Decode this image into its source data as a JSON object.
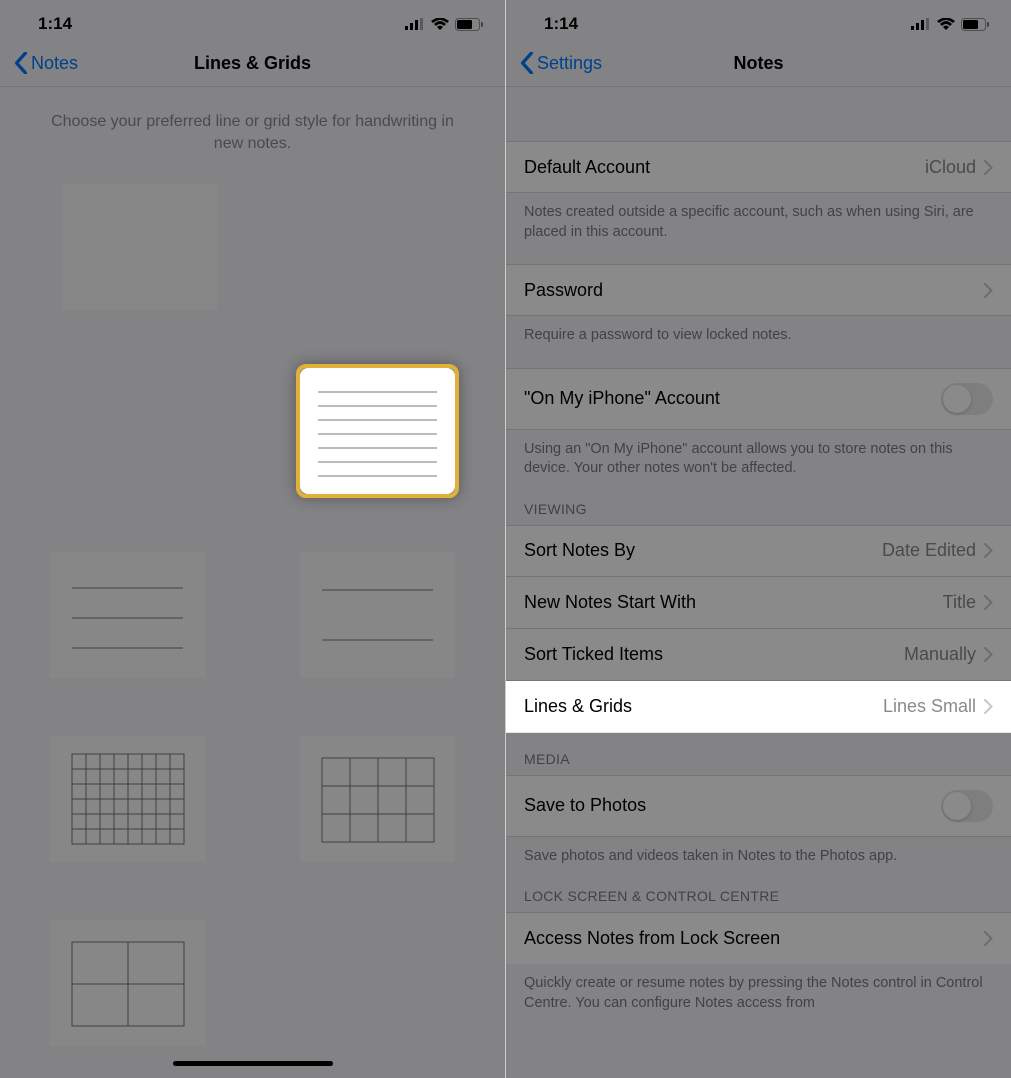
{
  "status": {
    "time": "1:14"
  },
  "left": {
    "back": "Notes",
    "title": "Lines & Grids",
    "desc": "Choose your preferred line or grid style for handwriting in new notes.",
    "swatches": [
      {
        "name": "blank"
      },
      {
        "name": "lines-small",
        "selected": true
      },
      {
        "name": "lines-medium"
      },
      {
        "name": "lines-large"
      },
      {
        "name": "grid-small"
      },
      {
        "name": "grid-medium"
      },
      {
        "name": "grid-large"
      }
    ]
  },
  "right": {
    "back": "Settings",
    "title": "Notes",
    "default_account": {
      "label": "Default Account",
      "value": "iCloud"
    },
    "default_account_footer": "Notes created outside a specific account, such as when using Siri, are placed in this account.",
    "password": {
      "label": "Password"
    },
    "password_footer": "Require a password to view locked notes.",
    "on_my_iphone": {
      "label": "\"On My iPhone\" Account"
    },
    "on_my_iphone_footer": "Using an \"On My iPhone\" account allows you to store notes on this device. Your other notes won't be affected.",
    "viewing_header": "Viewing",
    "sort_notes": {
      "label": "Sort Notes By",
      "value": "Date Edited"
    },
    "new_notes": {
      "label": "New Notes Start With",
      "value": "Title"
    },
    "sort_ticked": {
      "label": "Sort Ticked Items",
      "value": "Manually"
    },
    "lines_grids": {
      "label": "Lines & Grids",
      "value": "Lines Small"
    },
    "media_header": "Media",
    "save_photos": {
      "label": "Save to Photos"
    },
    "save_photos_footer": "Save photos and videos taken in Notes to the Photos app.",
    "lock_header": "Lock Screen & Control Centre",
    "access_lock": {
      "label": "Access Notes from Lock Screen"
    },
    "access_lock_footer": "Quickly create or resume notes by pressing the Notes control in Control Centre. You can configure Notes access from"
  }
}
